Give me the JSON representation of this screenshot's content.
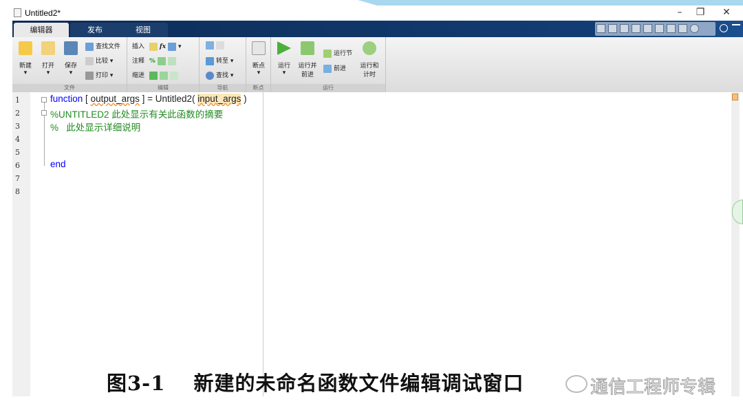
{
  "window": {
    "title": "Untitled2*"
  },
  "tabs": [
    {
      "label": "编辑器",
      "active": true
    },
    {
      "label": "发布"
    },
    {
      "label": "视图"
    }
  ],
  "ribbon": {
    "file": {
      "label": "文件",
      "new": "新建",
      "open": "打开",
      "save": "保存",
      "find_files": "查找文件",
      "compare": "比较",
      "print": "打印"
    },
    "edit": {
      "label": "编辑",
      "insert": "插入",
      "comment": "注释",
      "indent": "缩进",
      "fx": "fx",
      "percent": "%"
    },
    "navigate": {
      "label": "导航",
      "goto": "转至",
      "find": "查找"
    },
    "breakpoints": {
      "label": "断点",
      "breakpoints": "断点"
    },
    "run": {
      "label": "运行",
      "run": "运行",
      "run_advance": "运行并\n前进",
      "run_section": "运行节",
      "advance": "前进",
      "run_time": "运行和\n计时"
    }
  },
  "editor": {
    "line_numbers": [
      "1",
      "2",
      "3",
      "4",
      "5",
      "6",
      "7",
      "8"
    ],
    "lines": {
      "l1_kw": "function",
      "l1_a": " [ ",
      "l1_out": "output_args",
      "l1_b": " ] = Untitled2( ",
      "l1_in": "input_args",
      "l1_c": " )",
      "l2": "%UNTITLED2 此处显示有关此函数的摘要",
      "l3": "%   此处显示详细说明",
      "l6": "end"
    }
  },
  "caption": "图3-1　 新建的未命名函数文件编辑调试窗口",
  "watermark": "通信工程师专辑",
  "colors": {
    "keyword": "#0000ff",
    "comment": "#228b22",
    "tabbar": "#0d2b55"
  }
}
